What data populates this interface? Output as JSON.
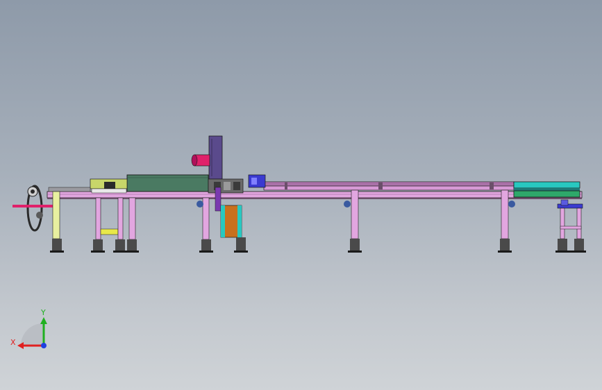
{
  "viewport": {
    "background_top": "#8e9aa9",
    "background_bottom": "#cfd3d7"
  },
  "model": {
    "colors": {
      "frame_pink": "#e2a6e0",
      "frame_pink_dark": "#b77db5",
      "rail_magenta": "#a05c9e",
      "cover_green": "#4a7a62",
      "roller_red": "#e0206a",
      "motor_purple": "#5a4a8c",
      "gearbox_orange": "#c8701e",
      "cyan_conveyor": "#28c8c0",
      "green_conveyor": "#2ea86a",
      "yellow_block": "#e8e84a",
      "blue_plate": "#3a3ad0",
      "foot_grey": "#4a4a4a",
      "outline": "#1a1a1a"
    },
    "icons": [
      "roller-icon",
      "motor-icon",
      "chain-icon"
    ]
  },
  "triad": {
    "x_label": "X",
    "y_label": "Y",
    "x_color": "#e02020",
    "y_color": "#20b020",
    "z_color": "#2040e0"
  }
}
